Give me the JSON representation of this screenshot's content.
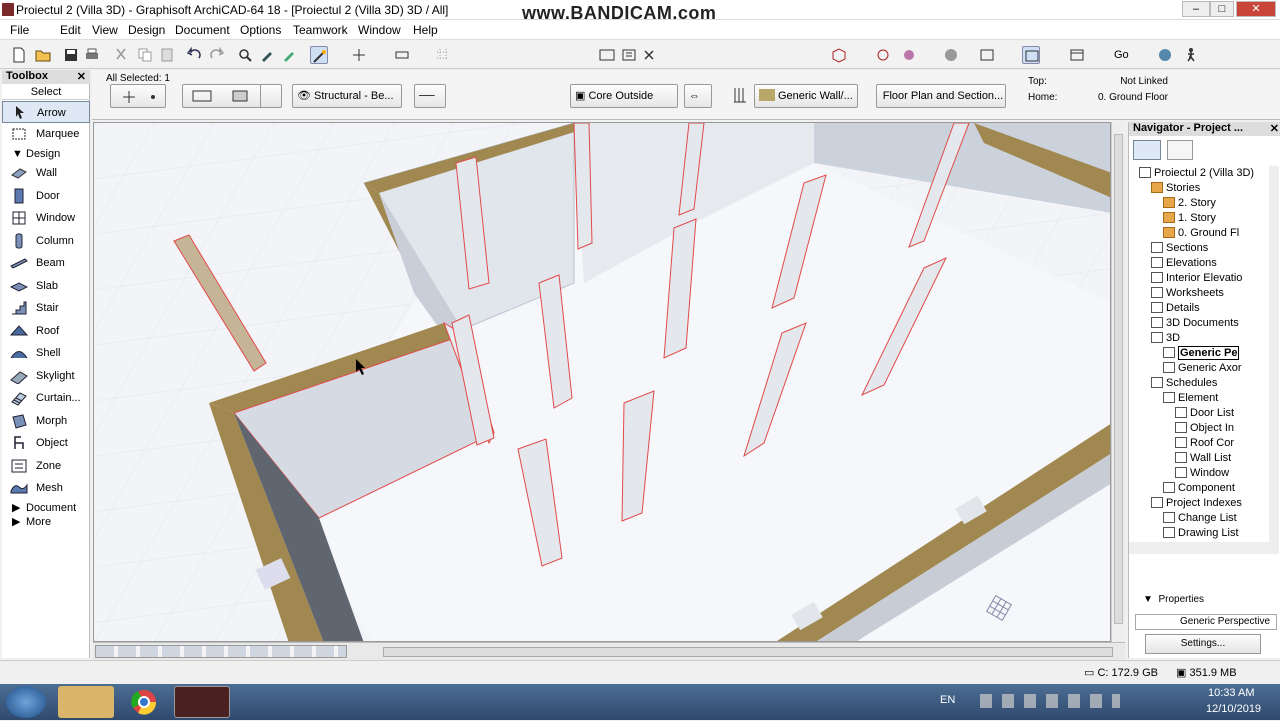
{
  "window": {
    "title": "Proiectul 2 (Villa 3D) - Graphisoft ArchiCAD-64 18 - [Proiectul 2 (Villa 3D) 3D / All]",
    "watermark": "www.BANDICAM.com",
    "min": "–",
    "max": "□",
    "close": "✕"
  },
  "menu": [
    "File",
    "Edit",
    "View",
    "Design",
    "Document",
    "Options",
    "Teamwork",
    "Window",
    "Help"
  ],
  "toolbar1": {
    "go_label": "Go"
  },
  "infobox": {
    "selected": "All Selected: 1",
    "structural": "Structural - Be...",
    "core": "Core Outside",
    "wall_type": "Generic Wall/...",
    "floor_plan": "Floor Plan and Section...",
    "top_label": "Top:",
    "top_value": "Not Linked",
    "home_label": "Home:",
    "home_value": "0. Ground Floor"
  },
  "toolbox": {
    "title": "Toolbox",
    "close": "✕",
    "select": "Select",
    "arrow": "Arrow",
    "marquee": "Marquee",
    "design": "Design",
    "tools": [
      "Wall",
      "Door",
      "Window",
      "Column",
      "Beam",
      "Slab",
      "Stair",
      "Roof",
      "Shell",
      "Skylight",
      "Curtain...",
      "Morph",
      "Object",
      "Zone",
      "Mesh"
    ],
    "document": "Document",
    "more": "More"
  },
  "navigator": {
    "title": "Navigator - Project ...",
    "close": "✕",
    "tree": [
      {
        "label": "Proiectul 2 (Villa 3D)",
        "indent": 0,
        "icon": "house"
      },
      {
        "label": "Stories",
        "indent": 1,
        "icon": "folder"
      },
      {
        "label": "2. Story",
        "indent": 2,
        "icon": "folder"
      },
      {
        "label": "1. Story",
        "indent": 2,
        "icon": "folder"
      },
      {
        "label": "0. Ground Fl",
        "indent": 2,
        "icon": "folder"
      },
      {
        "label": "Sections",
        "indent": 1,
        "icon": "doc"
      },
      {
        "label": "Elevations",
        "indent": 1,
        "icon": "doc"
      },
      {
        "label": "Interior Elevatio",
        "indent": 1,
        "icon": "doc"
      },
      {
        "label": "Worksheets",
        "indent": 1,
        "icon": "doc"
      },
      {
        "label": "Details",
        "indent": 1,
        "icon": "doc"
      },
      {
        "label": "3D Documents",
        "indent": 1,
        "icon": "doc"
      },
      {
        "label": "3D",
        "indent": 1,
        "icon": "doc"
      },
      {
        "label": "Generic Pe",
        "indent": 2,
        "icon": "eye",
        "selected": true
      },
      {
        "label": "Generic Axor",
        "indent": 2,
        "icon": "box"
      },
      {
        "label": "Schedules",
        "indent": 1,
        "icon": "doc"
      },
      {
        "label": "Element",
        "indent": 2,
        "icon": "doc"
      },
      {
        "label": "Door List",
        "indent": 3,
        "icon": "grid"
      },
      {
        "label": "Object In",
        "indent": 3,
        "icon": "grid"
      },
      {
        "label": "Roof Cor",
        "indent": 3,
        "icon": "grid"
      },
      {
        "label": "Wall List",
        "indent": 3,
        "icon": "grid"
      },
      {
        "label": "Window",
        "indent": 3,
        "icon": "grid"
      },
      {
        "label": "Component",
        "indent": 2,
        "icon": "doc"
      },
      {
        "label": "Project Indexes",
        "indent": 1,
        "icon": "doc"
      },
      {
        "label": "Change List",
        "indent": 2,
        "icon": "doc"
      },
      {
        "label": "Drawing List",
        "indent": 2,
        "icon": "doc"
      }
    ],
    "properties": "Properties",
    "view_name": "Generic Perspective",
    "settings": "Settings..."
  },
  "status": {
    "disk": "C: 172.9 GB",
    "memory": "351.9 MB"
  },
  "taskbar": {
    "lang": "EN",
    "time": "10:33 AM",
    "date": "12/10/2019"
  },
  "colors": {
    "wall_top": "#a08850",
    "wall_face": "#d6dbe3",
    "highlight": "#e24a4a",
    "selection": "#cfe0f4"
  }
}
